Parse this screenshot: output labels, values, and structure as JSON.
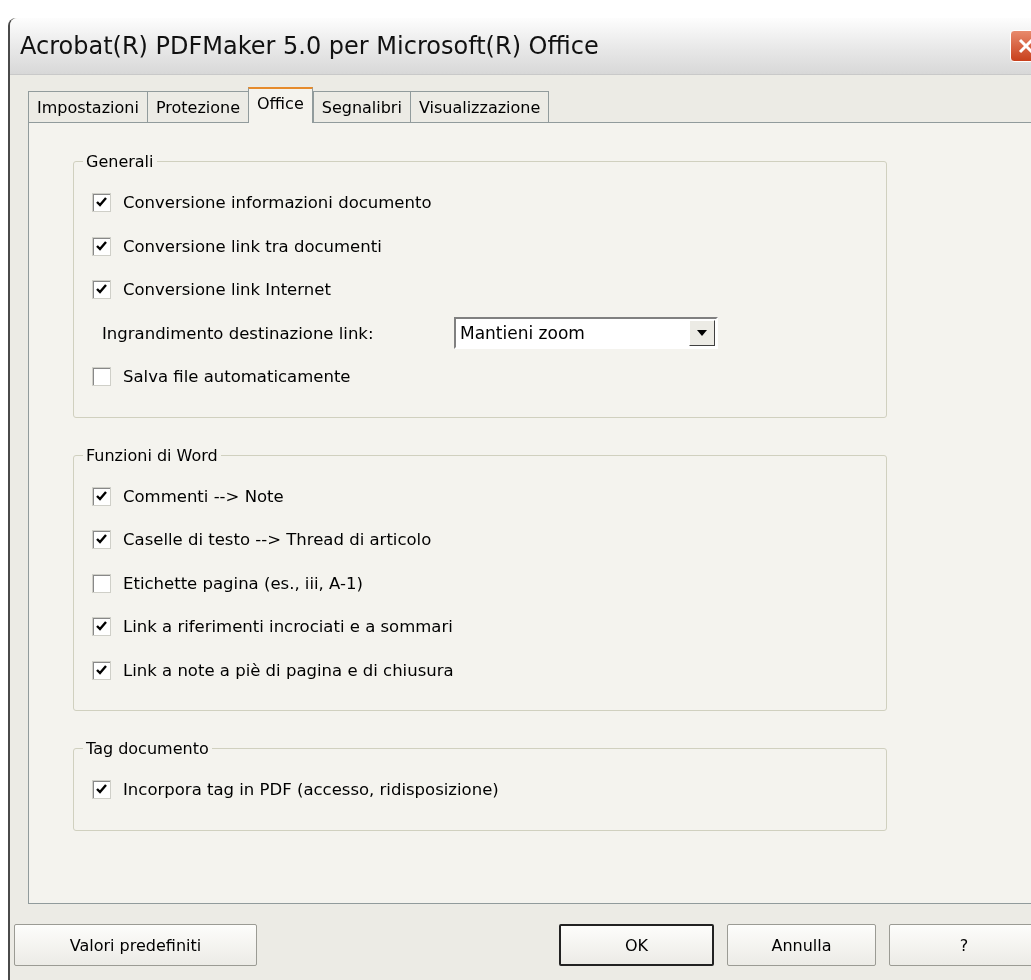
{
  "window": {
    "title": "Acrobat(R) PDFMaker 5.0 per Microsoft(R) Office"
  },
  "tabs": [
    {
      "label": "Impostazioni",
      "selected": false
    },
    {
      "label": "Protezione",
      "selected": false
    },
    {
      "label": "Office",
      "selected": true
    },
    {
      "label": "Segnalibri",
      "selected": false
    },
    {
      "label": "Visualizzazione",
      "selected": false
    }
  ],
  "groups": [
    {
      "title": "Generali",
      "items": [
        {
          "kind": "checkbox",
          "label": "Conversione informazioni documento",
          "checked": true
        },
        {
          "kind": "checkbox",
          "label": "Conversione link tra documenti",
          "checked": true
        },
        {
          "kind": "checkbox",
          "label": "Conversione link Internet",
          "checked": true
        },
        {
          "kind": "dropdown",
          "label": "Ingrandimento destinazione link:",
          "value": "Mantieni zoom"
        },
        {
          "kind": "checkbox",
          "label": "Salva file automaticamente",
          "checked": false
        }
      ]
    },
    {
      "title": "Funzioni di Word",
      "items": [
        {
          "kind": "checkbox",
          "label": "Commenti --> Note",
          "checked": true
        },
        {
          "kind": "checkbox",
          "label": "Caselle di testo --> Thread di articolo",
          "checked": true
        },
        {
          "kind": "checkbox",
          "label": "Etichette pagina (es., iii, A-1)",
          "checked": false
        },
        {
          "kind": "checkbox",
          "label": "Link a riferimenti incrociati e a sommari",
          "checked": true
        },
        {
          "kind": "checkbox",
          "label": "Link a note a piè di pagina e di chiusura",
          "checked": true
        }
      ]
    },
    {
      "title": "Tag documento",
      "items": [
        {
          "kind": "checkbox",
          "label": "Incorpora tag in PDF (accesso, ridisposizione)",
          "checked": true
        }
      ]
    }
  ],
  "buttons": [
    {
      "label": "Valori predefiniti",
      "default": false
    },
    {
      "label": "OK",
      "default": true
    },
    {
      "label": "Annulla",
      "default": false
    },
    {
      "label": "?",
      "default": false
    }
  ]
}
